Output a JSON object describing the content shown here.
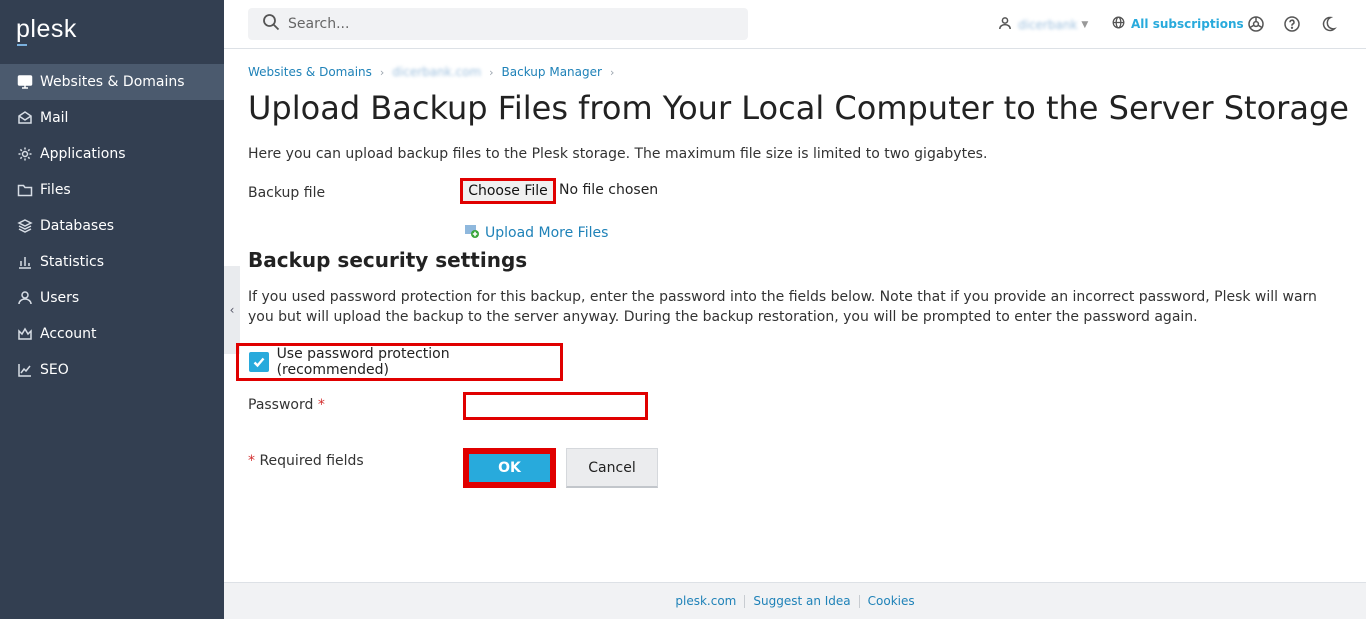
{
  "brand": {
    "logo": "plesk"
  },
  "sidebar": {
    "items": [
      {
        "label": "Websites & Domains",
        "icon": "monitor-icon",
        "active": true
      },
      {
        "label": "Mail",
        "icon": "mail-icon"
      },
      {
        "label": "Applications",
        "icon": "gear-icon"
      },
      {
        "label": "Files",
        "icon": "folder-icon"
      },
      {
        "label": "Databases",
        "icon": "database-icon"
      },
      {
        "label": "Statistics",
        "icon": "bar-chart-icon"
      },
      {
        "label": "Users",
        "icon": "user-icon"
      },
      {
        "label": "Account",
        "icon": "crown-icon"
      },
      {
        "label": "SEO",
        "icon": "trend-icon"
      }
    ]
  },
  "topbar": {
    "search_placeholder": "Search...",
    "user_name": "dicerbank",
    "subscriptions_label": "All subscriptions"
  },
  "breadcrumb": {
    "items": [
      "Websites & Domains",
      "dicerbank.com",
      "Backup Manager"
    ]
  },
  "page": {
    "title": "Upload Backup Files from Your Local Computer to the Server Storage",
    "intro": "Here you can upload backup files to the Plesk storage. The maximum file size is limited to two gigabytes.",
    "backup_file_label": "Backup file",
    "choose_file_label": "Choose File",
    "file_status": "No file chosen",
    "upload_more_label": "Upload More Files",
    "security_title": "Backup security settings",
    "security_desc": "If you used password protection for this backup, enter the password into the fields below. Note that if you provide an incorrect password, Plesk will warn you but will upload the backup to the server anyway. During the backup restoration, you will be prompted to enter the password again.",
    "use_password_label": "Use password protection (recommended)",
    "use_password_checked": true,
    "password_label": "Password",
    "password_value": "",
    "required_star": "*",
    "required_label": "Required fields",
    "ok_label": "OK",
    "cancel_label": "Cancel"
  },
  "footer": {
    "links": [
      "plesk.com",
      "Suggest an Idea",
      "Cookies"
    ]
  },
  "colors": {
    "sidebar_bg": "#333f51",
    "sidebar_active": "#4b5a6e",
    "accent": "#28aadc",
    "link": "#1f82b8",
    "highlight": "#e00000"
  }
}
